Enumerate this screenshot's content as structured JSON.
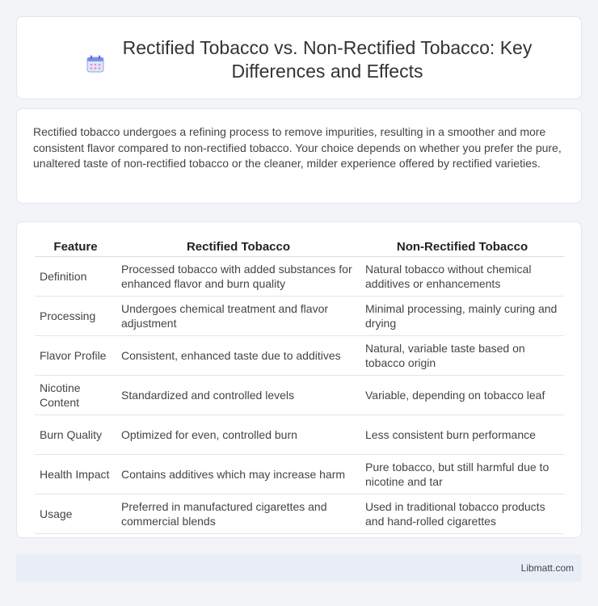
{
  "header": {
    "title": "Rectified Tobacco vs. Non-Rectified Tobacco: Key Differences and Effects",
    "icon": "calendar-icon"
  },
  "intro": {
    "text": "Rectified tobacco undergoes a refining process to remove impurities, resulting in a smoother and more consistent flavor compared to non-rectified tobacco. Your choice depends on whether you prefer the pure, unaltered taste of non-rectified tobacco or the cleaner, milder experience offered by rectified varieties."
  },
  "table": {
    "headers": [
      "Feature",
      "Rectified Tobacco",
      "Non-Rectified Tobacco"
    ],
    "rows": [
      [
        "Definition",
        "Processed tobacco with added substances for enhanced flavor and burn quality",
        "Natural tobacco without chemical additives or enhancements"
      ],
      [
        "Processing",
        "Undergoes chemical treatment and flavor adjustment",
        "Minimal processing, mainly curing and drying"
      ],
      [
        "Flavor Profile",
        "Consistent, enhanced taste due to additives",
        "Natural, variable taste based on tobacco origin"
      ],
      [
        "Nicotine Content",
        "Standardized and controlled levels",
        "Variable, depending on tobacco leaf"
      ],
      [
        "Burn Quality",
        "Optimized for even, controlled burn",
        "Less consistent burn performance"
      ],
      [
        "Health Impact",
        "Contains additives which may increase harm",
        "Pure tobacco, but still harmful due to nicotine and tar"
      ],
      [
        "Usage",
        "Preferred in manufactured cigarettes and commercial blends",
        "Used in traditional tobacco products and hand-rolled cigarettes"
      ]
    ]
  },
  "footer": {
    "site": "Libmatt.com"
  }
}
